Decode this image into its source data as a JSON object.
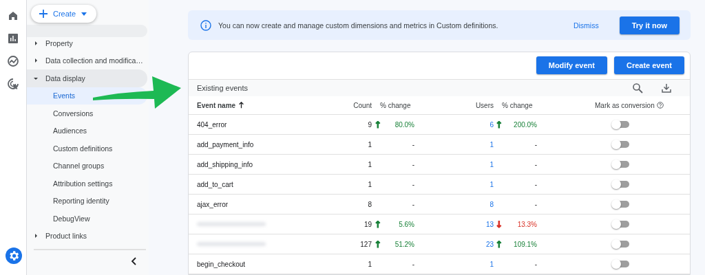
{
  "create_button": {
    "label": "Create"
  },
  "nav": [
    {
      "label": "Property",
      "expanded": false
    },
    {
      "label": "Data collection and modifica…",
      "expanded": false
    },
    {
      "label": "Data display",
      "expanded": true,
      "children": [
        {
          "label": "Events",
          "selected": true
        },
        {
          "label": "Conversions",
          "selected": false
        },
        {
          "label": "Audiences",
          "selected": false
        },
        {
          "label": "Custom definitions",
          "selected": false
        },
        {
          "label": "Channel groups",
          "selected": false
        },
        {
          "label": "Attribution settings",
          "selected": false
        },
        {
          "label": "Reporting identity",
          "selected": false
        },
        {
          "label": "DebugView",
          "selected": false
        }
      ]
    },
    {
      "label": "Product links",
      "expanded": false
    }
  ],
  "banner": {
    "message": "You can now create and manage custom dimensions and metrics in Custom definitions.",
    "dismiss": "Dismiss",
    "action": "Try it now"
  },
  "actions": [
    "Modify event",
    "Create event"
  ],
  "table": {
    "title": "Existing events",
    "columns": [
      "Event name",
      "Count",
      "% change",
      "Users",
      "% change",
      "Mark as conversion"
    ],
    "rows": [
      {
        "name": "404_error",
        "redacted": false,
        "count": "9",
        "count_trend": {
          "arrow": "↑",
          "color": "#188038"
        },
        "count_change": "80.0%",
        "users": "6",
        "users_trend": {
          "arrow": "↑",
          "color": "#188038"
        },
        "users_change": "200.0%",
        "conversion": false
      },
      {
        "name": "add_payment_info",
        "redacted": false,
        "count": "1",
        "count_change": "-",
        "users": "1",
        "users_change": "-",
        "conversion": false
      },
      {
        "name": "add_shipping_info",
        "redacted": false,
        "count": "1",
        "count_change": "-",
        "users": "1",
        "users_change": "-",
        "conversion": false
      },
      {
        "name": "add_to_cart",
        "redacted": false,
        "count": "1",
        "count_change": "-",
        "users": "1",
        "users_change": "-",
        "conversion": false
      },
      {
        "name": "ajax_error",
        "redacted": false,
        "count": "8",
        "count_change": "-",
        "users": "8",
        "users_change": "-",
        "conversion": false
      },
      {
        "redacted": true,
        "count": "19",
        "count_trend": {
          "arrow": "↑",
          "color": "#188038"
        },
        "count_change": "5.6%",
        "users": "13",
        "users_trend": {
          "arrow": "↓",
          "color": "#d93025"
        },
        "users_change": "13.3%",
        "conversion": false
      },
      {
        "redacted": true,
        "count": "127",
        "count_trend": {
          "arrow": "↑",
          "color": "#188038"
        },
        "count_change": "51.2%",
        "users": "23",
        "users_trend": {
          "arrow": "↑",
          "color": "#188038"
        },
        "users_change": "109.1%",
        "conversion": false
      },
      {
        "name": "begin_checkout",
        "redacted": false,
        "count": "1",
        "count_change": "-",
        "users": "1",
        "users_change": "-",
        "conversion": false
      }
    ]
  }
}
